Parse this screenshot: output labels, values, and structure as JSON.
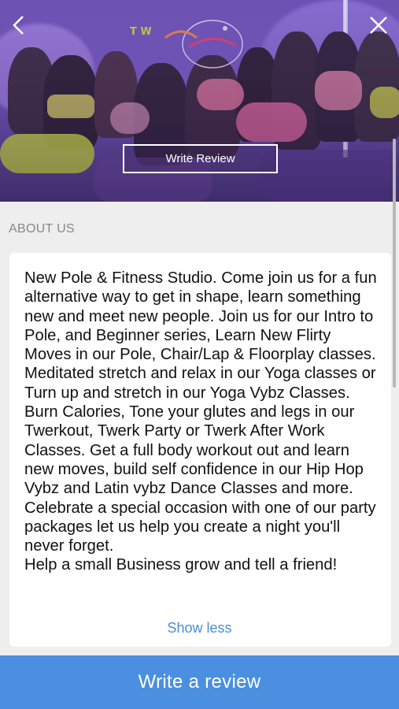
{
  "header": {
    "write_review_label": "Write Review",
    "back_icon": "chevron-left-icon",
    "close_icon": "close-icon"
  },
  "about": {
    "section_title": "ABOUT US",
    "description": "New Pole & Fitness Studio. Come join us for a fun alternative way to get in shape, learn something new and meet new people. Join us for our Intro to Pole, and Beginner series, Learn New Flirty Moves in our Pole, Chair/Lap & Floorplay classes. Meditated stretch and relax in our Yoga classes or Turn up and stretch in our Yoga Vybz Classes. Burn Calories, Tone your glutes and legs in our Twerkout, Twerk Party or Twerk After Work Classes. Get a full body workout out and learn new moves, build self confidence in our Hip Hop Vybz and Latin vybz Dance Classes and more.\nCelebrate a special occasion with one of our party packages let us help you create a night you'll never forget.\nHelp a small Business grow and tell a friend!",
    "show_less_label": "Show less"
  },
  "footer": {
    "write_review_label": "Write a review"
  },
  "colors": {
    "accent": "#4a8fe0",
    "link": "#4a8fd4",
    "hero_purple": "#7a5bc4"
  }
}
